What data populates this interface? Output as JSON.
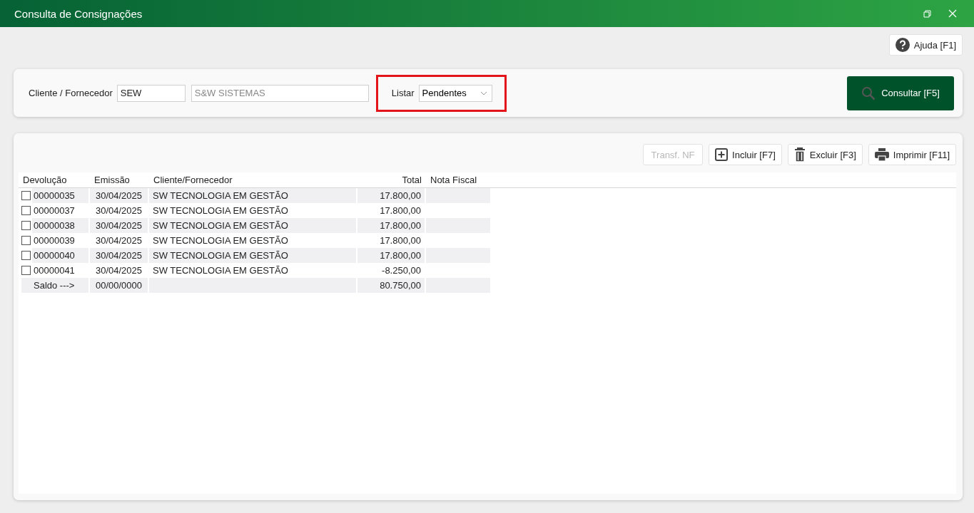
{
  "window": {
    "title": "Consulta de Consignações"
  },
  "help_button": {
    "label": "Ajuda [F1]"
  },
  "filter": {
    "client_label": "Cliente / Fornecedor",
    "client_code": "SEW",
    "client_name": "S&W SISTEMAS",
    "list_label": "Listar",
    "list_value": "Pendentes",
    "highlighted": true,
    "search_button": "Consultar [F5]"
  },
  "toolbar": [
    {
      "label": "Transf. NF",
      "kind": "plain",
      "disabled": true
    },
    {
      "label": "Incluir [F7]",
      "kind": "add",
      "disabled": false
    },
    {
      "label": "Excluir [F3]",
      "kind": "delete",
      "disabled": false
    },
    {
      "label": "Imprimir [F11]",
      "kind": "print",
      "disabled": false
    }
  ],
  "table": {
    "columns": [
      "Devolução",
      "Emissão",
      "Cliente/Fornecedor",
      "Total",
      "Nota Fiscal"
    ],
    "rows": [
      {
        "kind": "item",
        "checked": false,
        "cells": [
          "00000035",
          "30/04/2025",
          "SW TECNOLOGIA EM GESTÃO",
          "17.800,00"
        ]
      },
      {
        "kind": "item",
        "checked": false,
        "cells": [
          "00000037",
          "30/04/2025",
          "SW TECNOLOGIA EM GESTÃO",
          "17.800,00"
        ]
      },
      {
        "kind": "item",
        "checked": false,
        "cells": [
          "00000038",
          "30/04/2025",
          "SW TECNOLOGIA EM GESTÃO",
          "17.800,00"
        ]
      },
      {
        "kind": "item",
        "checked": false,
        "cells": [
          "00000039",
          "30/04/2025",
          "SW TECNOLOGIA EM GESTÃO",
          "17.800,00"
        ]
      },
      {
        "kind": "item",
        "checked": false,
        "cells": [
          "00000040",
          "30/04/2025",
          "SW TECNOLOGIA EM GESTÃO",
          "17.800,00"
        ]
      },
      {
        "kind": "item",
        "checked": false,
        "cells": [
          "00000041",
          "30/04/2025",
          "SW TECNOLOGIA EM GESTÃO",
          "-8.250,00"
        ]
      },
      {
        "kind": "total",
        "cells": [
          "Saldo --->",
          "00/00/0000",
          "",
          "80.750,00"
        ]
      }
    ]
  }
}
